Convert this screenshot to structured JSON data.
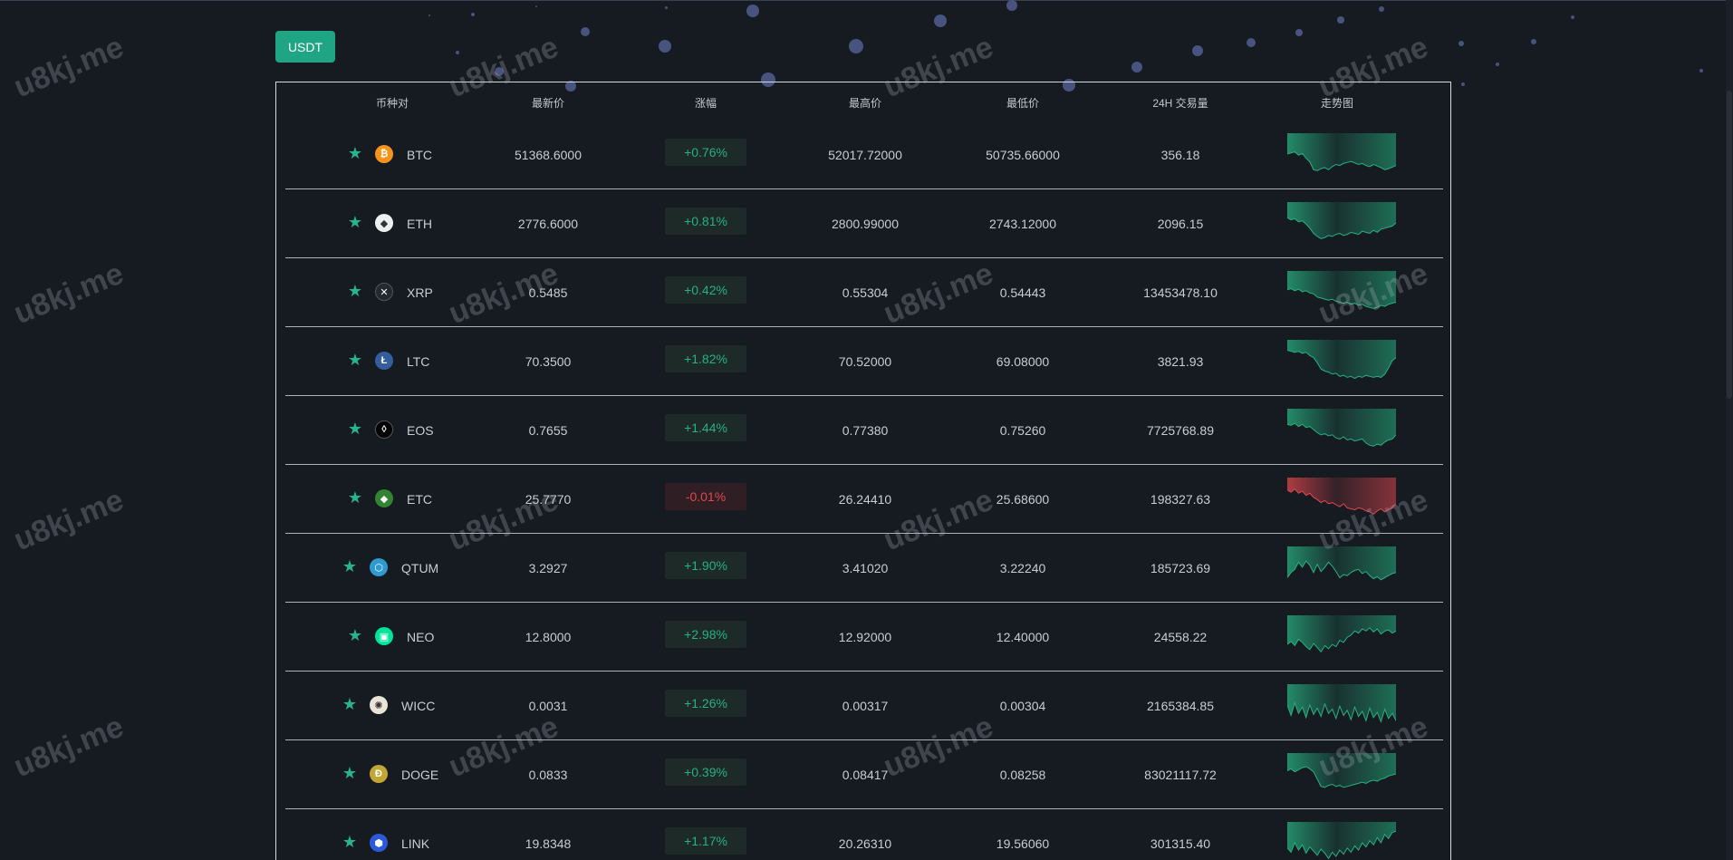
{
  "quote_tab": {
    "label": "USDT"
  },
  "columns": {
    "pair": "币种对",
    "last_price": "最新价",
    "change": "涨幅",
    "high": "最高价",
    "low": "最低价",
    "volume": "24H 交易量",
    "trend": "走势图"
  },
  "watermark": "u8kj.me",
  "colors": {
    "accent": "#1fa583",
    "up": "#26b17f",
    "down": "#e0464d",
    "background": "#161b22"
  },
  "rows": [
    {
      "symbol": "BTC",
      "icon": "bitcoin-icon",
      "icon_color": "#f7931a",
      "glyph": "₿",
      "last": "51368.6000",
      "change": "+0.76%",
      "direction": "up",
      "high": "52017.72000",
      "low": "50735.66000",
      "volume": "356.18",
      "trend": [
        40,
        38,
        36,
        42,
        39,
        48,
        55,
        70,
        72,
        68,
        66,
        70,
        64,
        60,
        62,
        58,
        56,
        54,
        57,
        60,
        58,
        62,
        64,
        60,
        63,
        66,
        70,
        68,
        65,
        62
      ]
    },
    {
      "symbol": "ETH",
      "icon": "ethereum-icon",
      "icon_color": "#ecf0f1",
      "glyph": "◆",
      "last": "2776.6000",
      "change": "+0.81%",
      "direction": "up",
      "high": "2800.99000",
      "low": "2743.12000",
      "volume": "2096.15",
      "trend": [
        30,
        34,
        32,
        38,
        36,
        42,
        50,
        60,
        66,
        70,
        68,
        64,
        66,
        62,
        60,
        64,
        62,
        58,
        60,
        62,
        56,
        58,
        60,
        54,
        58,
        52,
        50,
        48,
        46,
        40
      ]
    },
    {
      "symbol": "XRP",
      "icon": "ripple-icon",
      "icon_color": "#23292f",
      "glyph": "✕",
      "last": "0.5485",
      "change": "+0.42%",
      "direction": "up",
      "high": "0.55304",
      "low": "0.54443",
      "volume": "13453478.10",
      "trend": [
        36,
        34,
        38,
        35,
        40,
        38,
        42,
        44,
        50,
        52,
        54,
        56,
        54,
        58,
        60,
        62,
        60,
        64,
        62,
        66,
        64,
        68,
        70,
        72,
        70,
        66,
        68,
        64,
        62,
        60
      ]
    },
    {
      "symbol": "LTC",
      "icon": "litecoin-icon",
      "icon_color": "#345d9d",
      "glyph": "Ł",
      "last": "70.3500",
      "change": "+1.82%",
      "direction": "up",
      "high": "70.52000",
      "low": "69.08000",
      "volume": "3821.93",
      "trend": [
        20,
        22,
        24,
        22,
        26,
        24,
        30,
        34,
        44,
        56,
        60,
        62,
        66,
        64,
        70,
        68,
        72,
        70,
        74,
        70,
        72,
        68,
        70,
        72,
        70,
        72,
        66,
        54,
        40,
        34
      ]
    },
    {
      "symbol": "EOS",
      "icon": "eos-icon",
      "icon_color": "#000000",
      "glyph": "◊",
      "last": "0.7655",
      "change": "+1.44%",
      "direction": "up",
      "high": "0.77380",
      "low": "0.75260",
      "volume": "7725768.89",
      "trend": [
        30,
        32,
        28,
        34,
        30,
        36,
        34,
        40,
        46,
        50,
        48,
        52,
        50,
        56,
        58,
        54,
        60,
        58,
        62,
        60,
        58,
        66,
        70,
        72,
        68,
        70,
        64,
        60,
        58,
        50
      ]
    },
    {
      "symbol": "ETC",
      "icon": "ethereum-classic-icon",
      "icon_color": "#328332",
      "glyph": "◆",
      "last": "25.7770",
      "change": "-0.01%",
      "direction": "down",
      "high": "26.24410",
      "low": "25.68600",
      "volume": "198327.63",
      "trend": [
        24,
        28,
        22,
        30,
        26,
        34,
        30,
        38,
        42,
        48,
        44,
        50,
        48,
        52,
        56,
        50,
        58,
        60,
        62,
        58,
        60,
        64,
        66,
        70,
        64,
        60,
        66,
        62,
        58,
        50
      ]
    },
    {
      "symbol": "QTUM",
      "icon": "qtum-icon",
      "icon_color": "#2e9ad0",
      "glyph": "⬡",
      "last": "3.2927",
      "change": "+1.90%",
      "direction": "up",
      "high": "3.41020",
      "low": "3.22240",
      "volume": "185723.69",
      "trend": [
        60,
        50,
        44,
        30,
        40,
        28,
        36,
        50,
        34,
        48,
        40,
        30,
        38,
        48,
        60,
        54,
        56,
        50,
        46,
        44,
        52,
        48,
        56,
        62,
        58,
        64,
        60,
        56,
        52,
        50
      ]
    },
    {
      "symbol": "NEO",
      "icon": "neo-icon",
      "icon_color": "#00e599",
      "glyph": "▣",
      "last": "12.8000",
      "change": "+2.98%",
      "direction": "up",
      "high": "12.92000",
      "low": "12.40000",
      "volume": "24558.22",
      "trend": [
        56,
        50,
        58,
        46,
        52,
        60,
        66,
        54,
        62,
        70,
        58,
        64,
        56,
        60,
        48,
        52,
        42,
        38,
        30,
        34,
        26,
        30,
        24,
        32,
        26,
        36,
        30,
        28,
        34,
        30
      ]
    },
    {
      "symbol": "WICC",
      "icon": "waykichain-icon",
      "icon_color": "#e8e4d8",
      "glyph": "✺",
      "last": "0.0031",
      "change": "+1.26%",
      "direction": "up",
      "high": "0.00317",
      "low": "0.00304",
      "volume": "2165384.85",
      "trend": [
        40,
        60,
        36,
        56,
        44,
        64,
        40,
        58,
        46,
        62,
        38,
        56,
        48,
        66,
        42,
        60,
        50,
        68,
        44,
        62,
        52,
        70,
        46,
        64,
        54,
        72,
        48,
        66,
        56,
        70
      ]
    },
    {
      "symbol": "DOGE",
      "icon": "dogecoin-icon",
      "icon_color": "#c2a633",
      "glyph": "Ð",
      "last": "0.0833",
      "change": "+0.39%",
      "direction": "up",
      "high": "0.08417",
      "low": "0.08258",
      "volume": "83021117.72",
      "trend": [
        34,
        30,
        36,
        32,
        28,
        26,
        30,
        36,
        50,
        64,
        66,
        62,
        60,
        64,
        62,
        66,
        64,
        62,
        60,
        58,
        56,
        58,
        54,
        52,
        54,
        50,
        48,
        44,
        42,
        40
      ]
    },
    {
      "symbol": "LINK",
      "icon": "chainlink-icon",
      "icon_color": "#2a5ada",
      "glyph": "⬢",
      "last": "19.8348",
      "change": "+1.17%",
      "direction": "up",
      "high": "20.26310",
      "low": "19.56060",
      "volume": "301315.40",
      "trend": [
        50,
        58,
        40,
        54,
        44,
        60,
        48,
        56,
        64,
        52,
        60,
        70,
        58,
        66,
        54,
        62,
        50,
        58,
        46,
        54,
        40,
        48,
        36,
        44,
        30,
        40,
        24,
        32,
        20,
        18
      ]
    }
  ]
}
